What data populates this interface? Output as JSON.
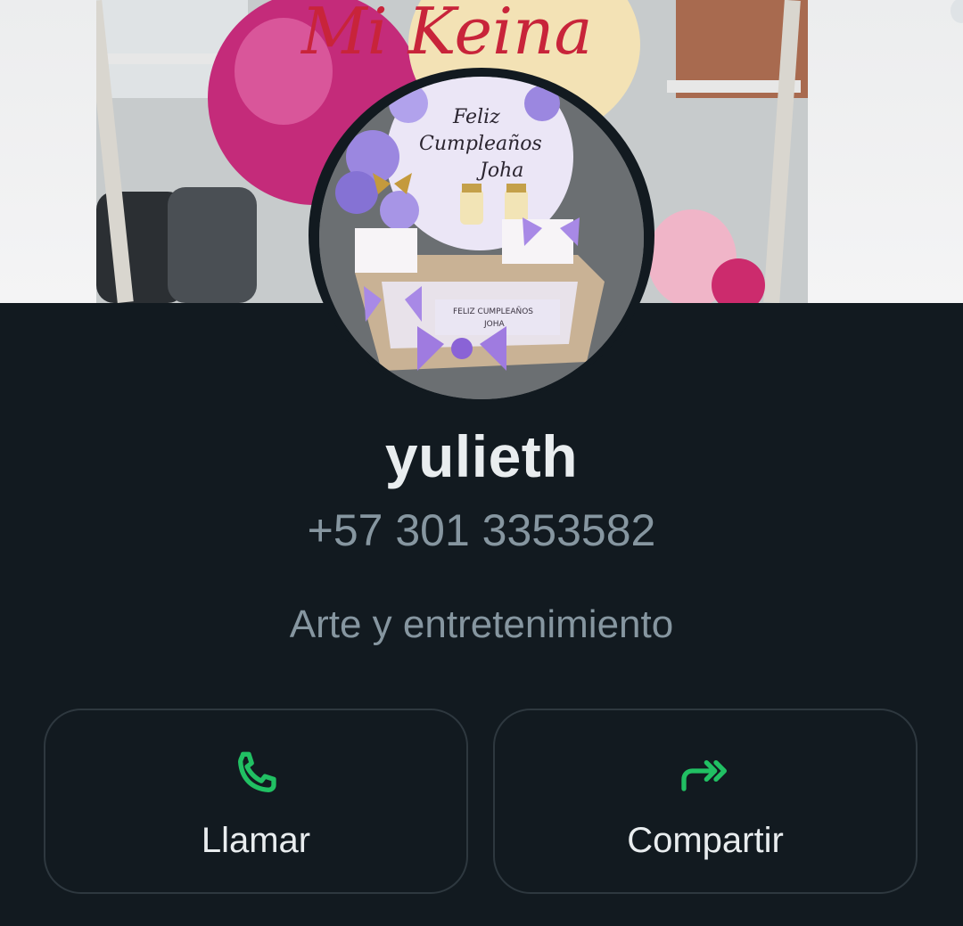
{
  "contact": {
    "name": "yulieth",
    "phone": "+57 301 3353582",
    "category": "Arte y entretenimiento"
  },
  "cover": {
    "description_icon": "photo-cover"
  },
  "avatar": {
    "icon": "profile-photo"
  },
  "actions": [
    {
      "label": "Llamar",
      "icon": "phone-icon"
    },
    {
      "label": "Compartir",
      "icon": "forward-icon"
    }
  ],
  "colors": {
    "background": "#121a20",
    "accent": "#21c063",
    "text_primary": "#e9edef",
    "text_secondary": "#8696a0",
    "button_border": "#2e383f"
  }
}
